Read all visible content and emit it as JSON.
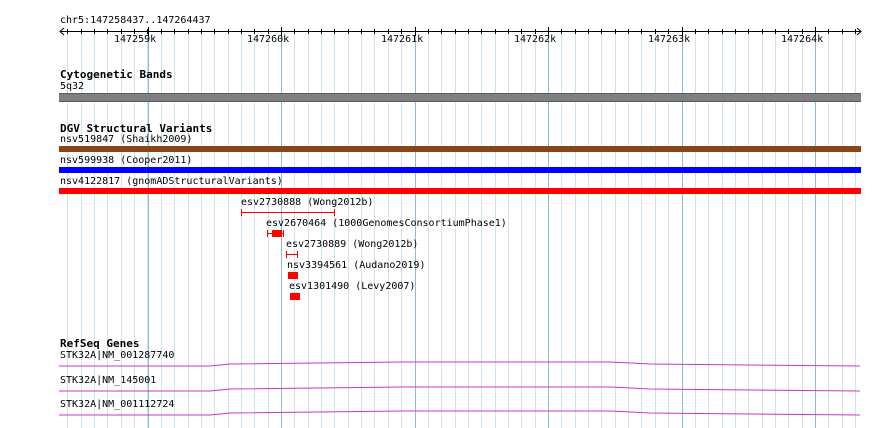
{
  "ruler": {
    "position": "chr5:147258437..147264437",
    "ticks": [
      "147259k",
      "147260k",
      "147261k",
      "147262k",
      "147263k",
      "147264k"
    ]
  },
  "tracks": {
    "cytoband": {
      "title": "Cytogenetic Bands",
      "band": "5q32",
      "color": "#808080"
    },
    "dgv": {
      "title": "DGV Structural Variants",
      "full_width": [
        {
          "label": "nsv519847 (Shaikh2009)",
          "color": "#8b4513"
        },
        {
          "label": "nsv599938 (Cooper2011)",
          "color": "#0000ff"
        },
        {
          "label": "nsv4122817 (gnomADStructuralVariants)",
          "color": "#ff0000"
        }
      ],
      "local": [
        {
          "label": "esv2730888 (Wong2012b)",
          "style": "line",
          "color": "#ff0000"
        },
        {
          "label": "esv2670464 (1000GenomesConsortiumPhase1)",
          "style": "box-line",
          "color": "#ff0000"
        },
        {
          "label": "esv2730889 (Wong2012b)",
          "style": "line",
          "color": "#ff0000"
        },
        {
          "label": "nsv3394561 (Audano2019)",
          "style": "box",
          "color": "#ff0000"
        },
        {
          "label": "esv1301490 (Levy2007)",
          "style": "box",
          "color": "#ff0000"
        }
      ]
    },
    "refseq": {
      "title": "RefSeq Genes",
      "genes": [
        {
          "label": "STK32A|NM_001287740",
          "color": "#cc33cc"
        },
        {
          "label": "STK32A|NM_145001",
          "color": "#cc33cc"
        },
        {
          "label": "STK32A|NM_001112724",
          "color": "#cc33cc"
        }
      ]
    }
  },
  "colors": {
    "grid_major": "#87c0d6",
    "grid_minor": "#cfe3ec"
  }
}
